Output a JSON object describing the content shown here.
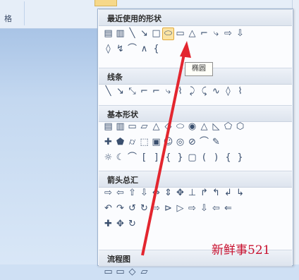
{
  "ribbon": {
    "left_label": "格",
    "active_tab_color": "#f6d88a"
  },
  "panel": {
    "sections": [
      {
        "title": "最近使用的形状",
        "rows": [
          [
            "▤",
            "▥",
            "╲",
            "↘",
            "□",
            "⬭",
            "▭",
            "△",
            "⌐",
            "⤷",
            "⇨",
            "⇩"
          ],
          [
            "◊",
            "↯",
            "⌒",
            "∧",
            "{"
          ]
        ]
      },
      {
        "title": "线条",
        "rows": [
          [
            "╲",
            "↘",
            "⤡",
            "⌐",
            "⌐",
            "⤷",
            "⌇",
            "⤸",
            "⤹",
            "∿",
            "◊",
            "⌇"
          ]
        ]
      },
      {
        "title": "基本形状",
        "rows": [
          [
            "▤",
            "▥",
            "▭",
            "▱",
            "△",
            "◇",
            "⬭",
            "◉",
            "△",
            "◺",
            "⬠",
            "⬡"
          ],
          [
            "✚",
            "⬟",
            "⌭",
            "⬚",
            "▣",
            "☺",
            "◎",
            "⊘",
            "⌒",
            "✎"
          ],
          [
            "☼",
            "☾",
            "⌒",
            "[",
            "]",
            "{",
            "}",
            "▢",
            "(",
            ")",
            "{",
            "}"
          ]
        ]
      },
      {
        "title": "箭头总汇",
        "rows": [
          [
            "⇨",
            "⇦",
            "⇧",
            "⇩",
            "⇔",
            "⇕",
            "✥",
            "⊥",
            "↱",
            "↰",
            "↲",
            "↳"
          ],
          [
            "↶",
            "↷",
            "↺",
            "↻",
            "⇨",
            "⊳",
            "▷",
            "⇨",
            "⇩",
            "⇦",
            "⇐"
          ],
          [
            "✚",
            "✥",
            "↻"
          ]
        ]
      },
      {
        "title": "流程图",
        "rows": [
          [
            "▭",
            "▭",
            "◇",
            "▱"
          ]
        ]
      }
    ],
    "selected_shape": "ellipse",
    "tooltip": "椭圆"
  },
  "annotation": {
    "arrow_color": "#e3262f"
  },
  "watermark": "新鲜事521"
}
